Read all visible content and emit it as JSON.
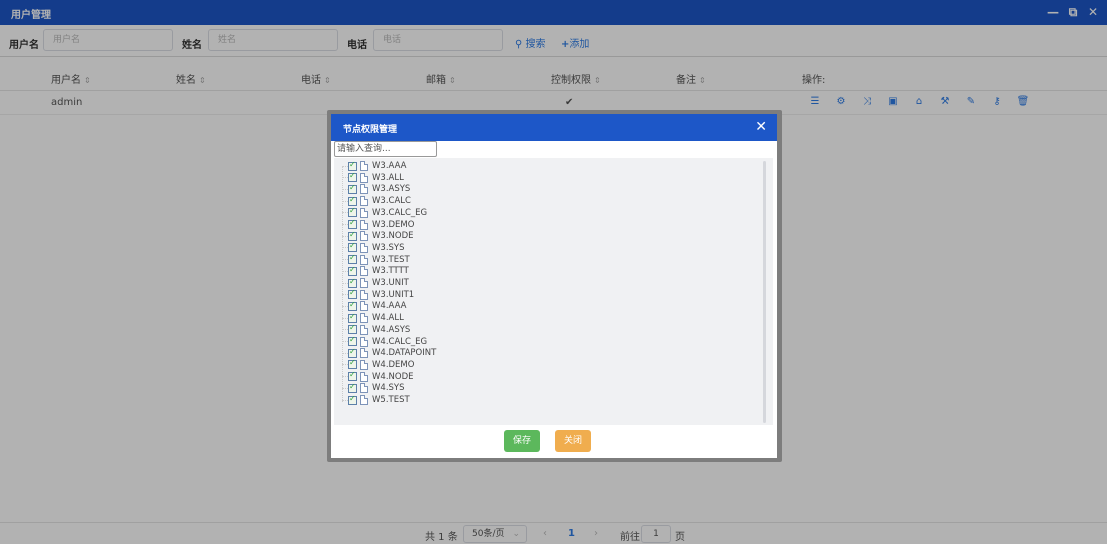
{
  "window": {
    "title": "用户管理",
    "controls": {
      "minimize": "—",
      "maximize": "⧉",
      "close": "✕"
    }
  },
  "search": {
    "fields": [
      {
        "label": "用户名",
        "placeholder": "用户名",
        "value": ""
      },
      {
        "label": "姓名",
        "placeholder": "姓名",
        "value": ""
      },
      {
        "label": "电话",
        "placeholder": "电话",
        "value": ""
      }
    ],
    "search_label": "搜索",
    "add_label": "添加"
  },
  "table": {
    "columns": [
      "用户名",
      "姓名",
      "电话",
      "邮箱",
      "控制权限",
      "备注",
      "操作:"
    ],
    "rows": [
      {
        "username": "admin",
        "name": "",
        "phone": "",
        "email": "",
        "control": true,
        "remark": ""
      }
    ],
    "row_actions": [
      "list-icon",
      "cogs-icon",
      "random-icon",
      "image-icon",
      "home-icon",
      "wrench-icon",
      "edit-icon",
      "key-icon",
      "trash-icon"
    ]
  },
  "pagination": {
    "total_label": "共 1 条",
    "page_size": "50条/页",
    "current_page": "1",
    "goto_label": "前往",
    "goto_value": "1",
    "page_suffix": "页"
  },
  "dialog": {
    "title": "节点权限管理",
    "filter_placeholder": "请输入查询...",
    "nodes": [
      {
        "label": "W3.AAA",
        "checked": true
      },
      {
        "label": "W3.ALL",
        "checked": true
      },
      {
        "label": "W3.ASYS",
        "checked": true
      },
      {
        "label": "W3.CALC",
        "checked": true
      },
      {
        "label": "W3.CALC_EG",
        "checked": true
      },
      {
        "label": "W3.DEMO",
        "checked": true
      },
      {
        "label": "W3.NODE",
        "checked": true
      },
      {
        "label": "W3.SYS",
        "checked": true
      },
      {
        "label": "W3.TEST",
        "checked": true
      },
      {
        "label": "W3.TTTT",
        "checked": true
      },
      {
        "label": "W3.UNIT",
        "checked": true
      },
      {
        "label": "W3.UNIT1",
        "checked": true
      },
      {
        "label": "W4.AAA",
        "checked": true
      },
      {
        "label": "W4.ALL",
        "checked": true
      },
      {
        "label": "W4.ASYS",
        "checked": true
      },
      {
        "label": "W4.CALC_EG",
        "checked": true
      },
      {
        "label": "W4.DATAPOINT",
        "checked": true
      },
      {
        "label": "W4.DEMO",
        "checked": true
      },
      {
        "label": "W4.NODE",
        "checked": true
      },
      {
        "label": "W4.SYS",
        "checked": true
      },
      {
        "label": "W5.TEST",
        "checked": true
      }
    ],
    "save_label": "保存",
    "close_label": "关闭"
  }
}
